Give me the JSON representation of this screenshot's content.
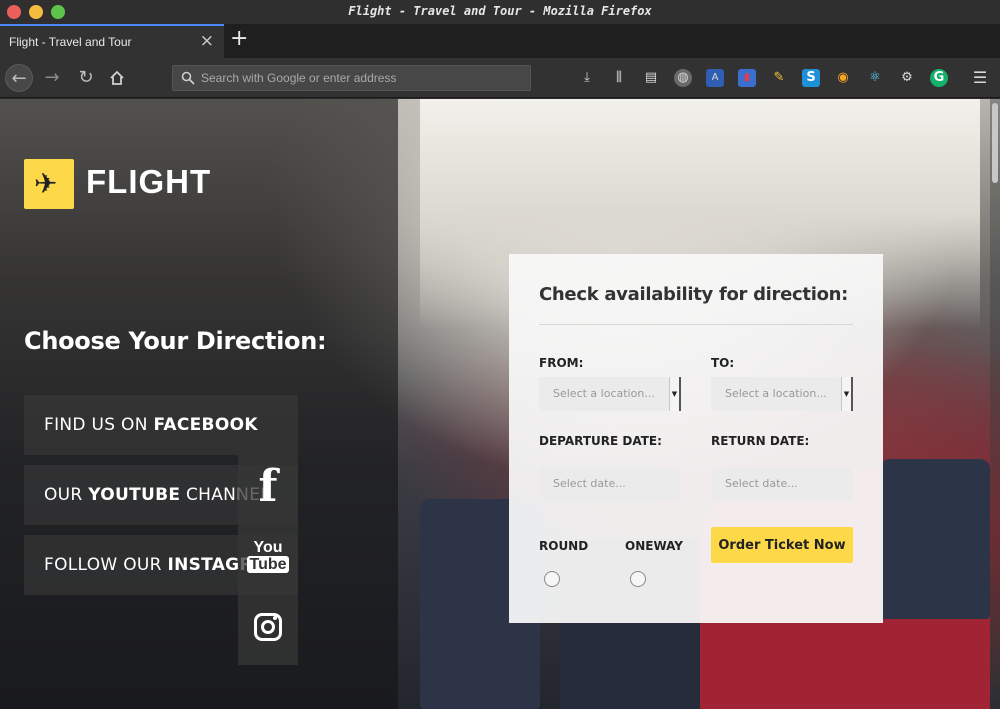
{
  "window": {
    "title": "Flight - Travel and Tour - Mozilla Firefox"
  },
  "tab": {
    "label": "Flight - Travel and Tour",
    "close": "×",
    "new_tab": "+"
  },
  "nav": {
    "url_placeholder": "Search with Google or enter address",
    "toolbar_icons": [
      "download-icon",
      "library-icon",
      "reader-icon",
      "globe-icon",
      "translate-icon",
      "extension-icon",
      "pen-icon",
      "skype-icon",
      "owl-icon",
      "react-icon",
      "gear-icon",
      "grammarly-icon",
      "menu-icon"
    ]
  },
  "brand": {
    "name": "FLIGHT"
  },
  "sidebar": {
    "heading": "Choose Your Direction:",
    "facebook": {
      "prefix": "FIND US ON ",
      "bold": "FACEBOOK",
      "suffix": ""
    },
    "youtube": {
      "prefix": "OUR ",
      "bold": "YOUTUBE",
      "suffix": " CHANNEL"
    },
    "instagram": {
      "prefix": "FOLLOW OUR ",
      "bold": "INSTAGRAM",
      "suffix": ""
    },
    "icons": {
      "facebook": "f",
      "youtube_top": "You",
      "youtube_bottom": "Tube"
    }
  },
  "form": {
    "title": "Check availability for direction:",
    "from_label": "FROM:",
    "to_label": "TO:",
    "from_placeholder": "Select a location...",
    "to_placeholder": "Select a location...",
    "departure_label": "DEPARTURE DATE:",
    "return_label": "RETURN DATE:",
    "departure_placeholder": "Select date...",
    "return_placeholder": "Select date...",
    "round_label": "ROUND",
    "oneway_label": "ONEWAY",
    "order_button": "Order Ticket Now"
  },
  "colors": {
    "accent": "#fdd94a",
    "tab_accent": "#4a8af4"
  }
}
